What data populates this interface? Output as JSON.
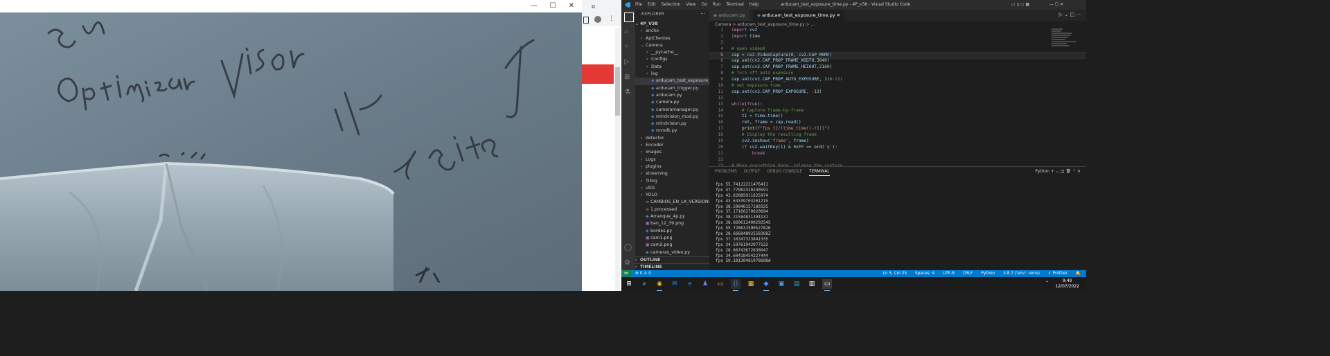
{
  "camera_window": {
    "controls": {
      "minimize": "—",
      "maximize": "☐",
      "close": "✕"
    }
  },
  "vscode": {
    "menu": [
      "File",
      "Edit",
      "Selection",
      "View",
      "Go",
      "Run",
      "Terminal",
      "Help"
    ],
    "title": "arducam_test_exposure_time.py - 4P_v38 - Visual Studio Code",
    "explorer_header": "EXPLORER",
    "workspace": "4P_V38",
    "tree": [
      {
        "label": "ancho",
        "type": "folder",
        "depth": 1,
        "open": false
      },
      {
        "label": "ApiClientes",
        "type": "folder",
        "depth": 1,
        "open": false
      },
      {
        "label": "Camera",
        "type": "folder",
        "depth": 1,
        "open": true
      },
      {
        "label": "__pycache__",
        "type": "folder",
        "depth": 2,
        "open": false
      },
      {
        "label": "Configs",
        "type": "folder",
        "depth": 2,
        "open": false
      },
      {
        "label": "Data",
        "type": "folder",
        "depth": 2,
        "open": false
      },
      {
        "label": "log",
        "type": "folder",
        "depth": 2,
        "open": false
      },
      {
        "label": "arducam_test_exposure_time.py",
        "type": "py",
        "depth": 2,
        "active": true
      },
      {
        "label": "arducam_trigger.py",
        "type": "py",
        "depth": 2
      },
      {
        "label": "arducam.py",
        "type": "py",
        "depth": 2
      },
      {
        "label": "camera.py",
        "type": "py",
        "depth": 2
      },
      {
        "label": "cameramanager.py",
        "type": "py",
        "depth": 2
      },
      {
        "label": "mindvision_mod.py",
        "type": "py",
        "depth": 2
      },
      {
        "label": "mindvision.py",
        "type": "py",
        "depth": 2
      },
      {
        "label": "mvsdk.py",
        "type": "py",
        "depth": 2
      },
      {
        "label": "detector",
        "type": "folder",
        "depth": 1,
        "open": false
      },
      {
        "label": "Encoder",
        "type": "folder",
        "depth": 1,
        "open": false
      },
      {
        "label": "images",
        "type": "folder",
        "depth": 1,
        "open": false
      },
      {
        "label": "Logs",
        "type": "folder",
        "depth": 1,
        "open": false
      },
      {
        "label": "plugins",
        "type": "folder",
        "depth": 1,
        "open": false
      },
      {
        "label": "streaming",
        "type": "folder",
        "depth": 1,
        "open": false
      },
      {
        "label": "Tiling",
        "type": "folder",
        "depth": 1,
        "open": false
      },
      {
        "label": "utils",
        "type": "folder",
        "depth": 1,
        "open": false
      },
      {
        "label": "YOLO",
        "type": "folder",
        "depth": 1,
        "open": false
      },
      {
        "label": "CAMBIOS_EN_LA_VERSION!!...",
        "type": "file",
        "depth": 1
      },
      {
        "label": "1.processed",
        "type": "file",
        "depth": 1
      },
      {
        "label": "Arranque_4p.py",
        "type": "py",
        "depth": 1
      },
      {
        "label": "ban_12_39.png",
        "type": "png",
        "depth": 1
      },
      {
        "label": "bordes.py",
        "type": "py",
        "depth": 1
      },
      {
        "label": "cam1.png",
        "type": "png",
        "depth": 1
      },
      {
        "label": "cam2.png",
        "type": "png",
        "depth": 1
      },
      {
        "label": "cameras_video.py",
        "type": "py",
        "depth": 1
      }
    ],
    "outline": "OUTLINE",
    "timeline": "TIMELINE",
    "tabs": [
      {
        "label": "arducam.py",
        "active": false
      },
      {
        "label": "arducam_test_exposure_time.py",
        "active": true
      }
    ],
    "breadcrumb": "Camera > arducam_test_exposure_time.py > ...",
    "code": [
      [
        [
          "kw",
          "import "
        ],
        [
          "tx",
          "cv2"
        ]
      ],
      [
        [
          "kw",
          "import "
        ],
        [
          "tx",
          "time"
        ]
      ],
      [],
      [
        [
          "cm",
          "# open video0"
        ]
      ],
      [
        [
          "tx",
          "cap = cv2.VideoCapture("
        ],
        [
          "nm",
          "0"
        ],
        [
          "tx",
          ", cv2.CAP_MSMF)"
        ]
      ],
      [
        [
          "tx",
          "cap.set(cv2.CAP_PROP_FRAME_WIDTH,"
        ],
        [
          "nm",
          "3840"
        ],
        [
          "tx",
          ")"
        ]
      ],
      [
        [
          "tx",
          "cap.set(cv2.CAP_PROP_FRAME_HEIGHT,"
        ],
        [
          "nm",
          "2160"
        ],
        [
          "tx",
          ")"
        ]
      ],
      [
        [
          "cm",
          "# Turn off auto exposure"
        ]
      ],
      [
        [
          "tx",
          "cap.set(cv2.CAP_PROP_AUTO_EXPOSURE, "
        ],
        [
          "nm",
          "1"
        ],
        [
          "tx",
          ")"
        ],
        [
          "cm",
          "#-13)"
        ]
      ],
      [
        [
          "cm",
          "# set exposure time"
        ]
      ],
      [
        [
          "tx",
          "cap.set(cv2.CAP_PROP_EXPOSURE, "
        ],
        [
          "nm",
          "-13"
        ],
        [
          "tx",
          ")"
        ]
      ],
      [],
      [
        [
          "kw2",
          "while"
        ],
        [
          "tx",
          "("
        ],
        [
          "kw",
          "True"
        ],
        [
          "tx",
          "):"
        ]
      ],
      [
        [
          "tx",
          "    "
        ],
        [
          "cm",
          "# Capture frame-by-frame"
        ]
      ],
      [
        [
          "tx",
          "    t1 = time.time()"
        ]
      ],
      [
        [
          "tx",
          "    ret, frame = cap.read()"
        ]
      ],
      [
        [
          "tx",
          "    "
        ],
        [
          "fn",
          "print"
        ],
        [
          "tx",
          "("
        ],
        [
          "st",
          "f\"fps {1/(time.time()-t1)}\""
        ],
        [
          "tx",
          ")"
        ]
      ],
      [
        [
          "tx",
          "    "
        ],
        [
          "cm",
          "# Display the resulting frame"
        ]
      ],
      [
        [
          "tx",
          "    cv2.imshow("
        ],
        [
          "st",
          "'frame'"
        ],
        [
          "tx",
          ", frame)"
        ]
      ],
      [
        [
          "tx",
          "    "
        ],
        [
          "kw2",
          "if"
        ],
        [
          "tx",
          " cv2.waitKey("
        ],
        [
          "nm",
          "1"
        ],
        [
          "tx",
          ") & "
        ],
        [
          "nm",
          "0xFF"
        ],
        [
          "tx",
          " == "
        ],
        [
          "fn",
          "ord"
        ],
        [
          "tx",
          "("
        ],
        [
          "st",
          "'q'"
        ],
        [
          "tx",
          "):"
        ]
      ],
      [
        [
          "tx",
          "        "
        ],
        [
          "kw2",
          "break"
        ]
      ],
      [],
      [
        [
          "cm",
          "# When everything done, release the capture"
        ]
      ]
    ],
    "current_line": 5,
    "panel_tabs": [
      "PROBLEMS",
      "OUTPUT",
      "DEBUG CONSOLE",
      "TERMINAL"
    ],
    "panel_selected": "TERMINAL",
    "shell": "Python",
    "terminal_lines": [
      "fps 55.74122221476411",
      "fps 47.77982320240591",
      "fps 43.62885911625974",
      "fps 43.63339703201215",
      "fps 38.59848157180325",
      "fps 37.17160270620694",
      "fps 38.21584831394131",
      "fps 28.66061240029254S",
      "fps 55.72863159052782б",
      "fps 28.66684892558368Z",
      "fps 37.16347323841335",
      "fps 34.59761942077522",
      "fps 28.66743672638047",
      "fps 34.60418454227444",
      "fps 50.18130481078688A"
    ],
    "status": {
      "errors": "⊗ 0 ⚠ 0",
      "cursor": "Ln 5, Col 25",
      "spaces": "Spaces: 4",
      "encoding": "UTF-8",
      "eol": "CRLF",
      "language": "Python",
      "interpreter": "3.8.7 ('env': venv)",
      "prettier": "✓ Prettier"
    }
  },
  "taskbar": {
    "time": "9:49",
    "date": "12/07/2022"
  },
  "colors": {
    "keyword": "#c586c0",
    "keyword_blue": "#569cd6",
    "comment": "#6a9955",
    "number": "#b5cea8",
    "string": "#ce9178",
    "function": "#dcdcaa",
    "module": "#4ec9b0",
    "status_bar": "#007acc"
  }
}
